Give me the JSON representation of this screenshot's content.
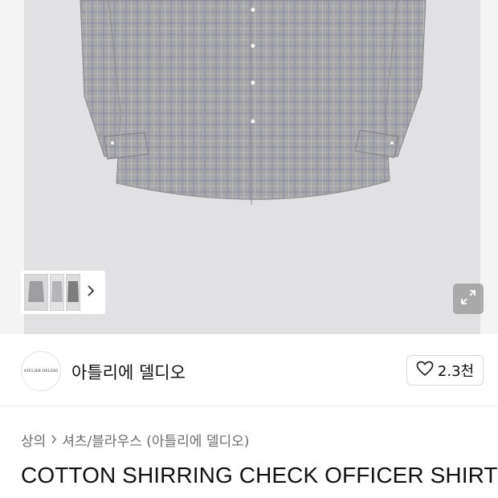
{
  "gallery": {
    "image_alt": "Gray check shirt product photo",
    "thumbnail_count": 3,
    "next_icon": "chevron-right-icon",
    "expand_icon": "expand-icon"
  },
  "brand": {
    "logo_text": "ATELIER DELDIO",
    "name": "아틀리에 델디오",
    "like_icon": "heart-outline-icon",
    "like_count": "2.3천"
  },
  "breadcrumb": {
    "items": [
      "상의",
      "셔츠/블라우스 (아틀리에 델디오)"
    ],
    "separator_icon": "chevron-right-icon"
  },
  "product": {
    "title": "COTTON SHIRRING CHECK OFFICER SHIRT"
  },
  "colors": {
    "image_background": "#e1e1e3",
    "shirt_base": "#a6a6a8",
    "check_line": "#8a8fa6"
  }
}
